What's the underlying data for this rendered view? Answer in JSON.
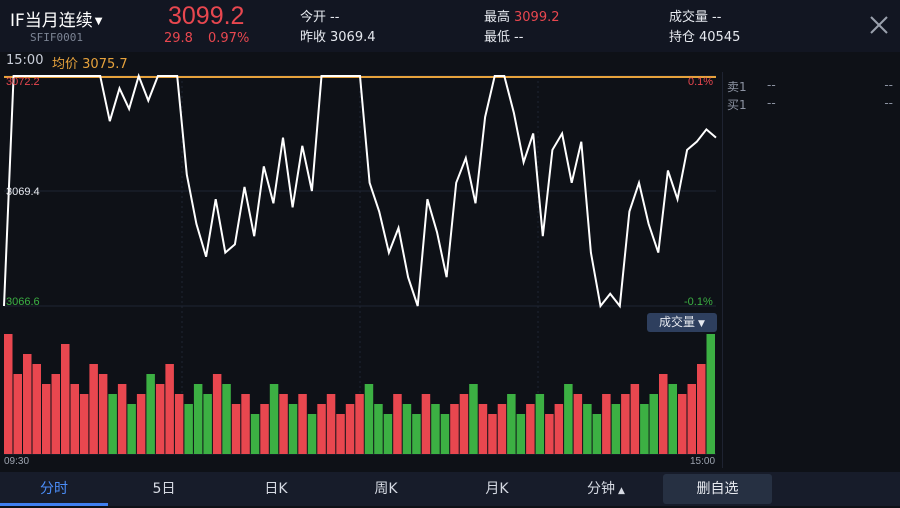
{
  "header": {
    "title": "IF当月连续",
    "code": "SFIF0001",
    "price": "3099.2",
    "change": "29.8",
    "change_pct": "0.97%",
    "open_label": "今开",
    "open_value": "--",
    "prev_close_label": "昨收",
    "prev_close_value": "3069.4",
    "high_label": "最高",
    "high_value": "3099.2",
    "low_label": "最低",
    "low_value": "--",
    "volume_label": "成交量",
    "volume_value": "--",
    "open_interest_label": "持仓",
    "open_interest_value": "40545"
  },
  "subbar": {
    "time": "15:00",
    "avg_label": "均价",
    "avg_value": "3075.7"
  },
  "price_axis": {
    "top": "3072.2",
    "mid": "3069.4",
    "bottom": "3066.6",
    "top_pct": "0.1%",
    "bottom_pct": "-0.1%"
  },
  "volume_button": "成交量",
  "time_axis": {
    "start": "09:30",
    "end": "15:00"
  },
  "orderbook": [
    {
      "label": "卖1",
      "price": "--",
      "qty": "--"
    },
    {
      "label": "买1",
      "price": "--",
      "qty": "--"
    }
  ],
  "tabs": [
    "分时",
    "5日",
    "日K",
    "周K",
    "月K",
    "分钟"
  ],
  "fav_button": "删自选",
  "colors": {
    "up": "#e8474f",
    "down": "#3cb043",
    "avg": "#e6a23c",
    "accent": "#4b8df8"
  },
  "chart_data": {
    "type": "line",
    "ylim": [
      3066.6,
      3072.2
    ],
    "x": [
      "09:30",
      "15:00"
    ],
    "series": [
      {
        "values": [
          3066.6,
          3072.2,
          3072.2,
          3072.2,
          3072.2,
          3072.2,
          3072.2,
          3072.2,
          3072.2,
          3072.2,
          3072.2,
          3071.1,
          3071.9,
          3071.4,
          3072.2,
          3071.6,
          3072.2,
          3072.2,
          3072.2,
          3069.8,
          3068.6,
          3067.8,
          3069.2,
          3067.9,
          3068.1,
          3069.5,
          3068.3,
          3070.0,
          3069.1,
          3070.7,
          3069.0,
          3070.5,
          3069.4,
          3072.2,
          3072.2,
          3072.2,
          3072.2,
          3072.2,
          3069.6,
          3068.9,
          3067.9,
          3068.5,
          3067.3,
          3066.6,
          3069.2,
          3068.4,
          3067.3,
          3069.6,
          3070.2,
          3069.1,
          3071.2,
          3072.2,
          3072.2,
          3071.3,
          3070.1,
          3070.8,
          3068.3,
          3070.4,
          3070.8,
          3069.6,
          3070.6,
          3067.9,
          3066.6,
          3066.9,
          3066.6,
          3068.9,
          3069.6,
          3068.6,
          3067.9,
          3069.9,
          3069.2,
          3070.4,
          3070.6,
          3070.9,
          3070.7
        ]
      }
    ],
    "volumes": [
      12,
      8,
      10,
      9,
      7,
      8,
      11,
      7,
      6,
      9,
      8,
      6,
      7,
      5,
      6,
      8,
      7,
      9,
      6,
      5,
      7,
      6,
      8,
      7,
      5,
      6,
      4,
      5,
      7,
      6,
      5,
      6,
      4,
      5,
      6,
      4,
      5,
      6,
      7,
      5,
      4,
      6,
      5,
      4,
      6,
      5,
      4,
      5,
      6,
      7,
      5,
      4,
      5,
      6,
      4,
      5,
      6,
      4,
      5,
      7,
      6,
      5,
      4,
      6,
      5,
      6,
      7,
      5,
      6,
      8,
      7,
      6,
      7,
      9,
      12
    ]
  }
}
